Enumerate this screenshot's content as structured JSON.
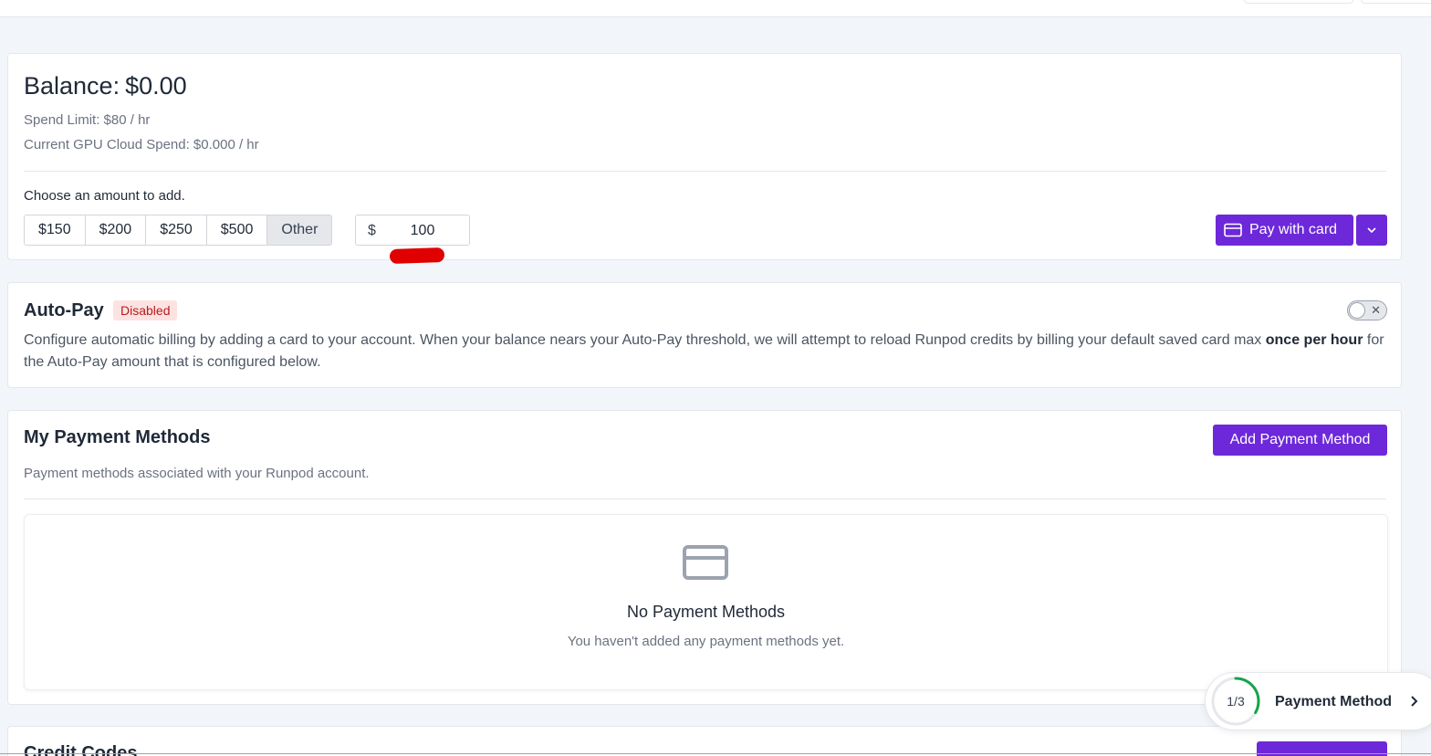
{
  "balance": {
    "label": "Balance:",
    "amount": "$0.00",
    "spend_limit": "Spend Limit: $80 / hr",
    "gpu_spend": "Current GPU Cloud Spend: $0.000 / hr",
    "choose_label": "Choose an amount to add.",
    "amount_options": [
      "$150",
      "$200",
      "$250",
      "$500",
      "Other"
    ],
    "selected_option": "Other",
    "currency_symbol": "$",
    "custom_amount": "100",
    "pay_button": "Pay with card"
  },
  "autopay": {
    "title": "Auto-Pay",
    "status_badge": "Disabled",
    "description_before": "Configure automatic billing by adding a card to your account. When your balance nears your Auto-Pay threshold, we will attempt to reload Runpod credits by billing your default saved card max ",
    "description_bold": "once per hour",
    "description_after": " for the Auto-Pay amount that is configured below.",
    "toggle_on": false
  },
  "payment_methods": {
    "title": "My Payment Methods",
    "subtitle": "Payment methods associated with your Runpod account.",
    "add_button": "Add Payment Method",
    "empty_title": "No Payment Methods",
    "empty_subtitle": "You haven't added any payment methods yet."
  },
  "credit_codes": {
    "title": "Credit Codes"
  },
  "onboarding": {
    "step": "1/3",
    "progress": 0.333,
    "label": "Payment Method"
  },
  "colors": {
    "accent": "#6d28d9",
    "badge_bg": "#fde2e2",
    "badge_text": "#b91c1c",
    "progress_ring": "#16a34a"
  }
}
